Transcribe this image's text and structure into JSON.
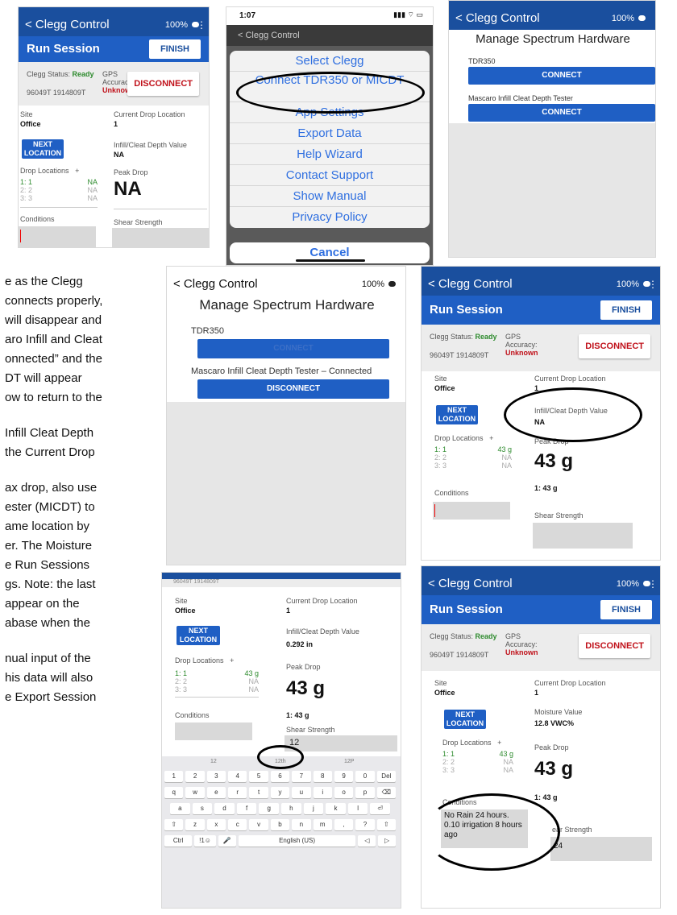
{
  "colors": {
    "app_blue": "#1a4f9e",
    "run_blue": "#1f5fc4",
    "ready_green": "#2e8b2e",
    "unknown_red": "#c0111a",
    "ios_blue": "#2f6fe0"
  },
  "common": {
    "back_title": "< Clegg Control",
    "battery_pct": "100%",
    "run_session": "Run Session",
    "finish": "FINISH",
    "clegg_status_label": "Clegg Status:",
    "clegg_status_value": "Ready",
    "gps_label": "GPS Accuracy:",
    "gps_value": "Unknown",
    "disconnect": "DISCONNECT",
    "serial": "96049T 1914809T",
    "site_label": "Site",
    "site_value": "Office",
    "current_drop_label": "Current Drop Location",
    "current_drop_value": "1",
    "next_location": "NEXT LOCATION",
    "drop_locations": "Drop Locations",
    "add_icon": "+",
    "peak_drop": "Peak Drop",
    "conditions": "Conditions",
    "shear_strength": "Shear Strength",
    "infill_label": "Infill/Cleat Depth Value"
  },
  "shot1": {
    "drops": [
      {
        "loc": "1: 1",
        "val": "NA"
      },
      {
        "loc": "2: 2",
        "val": "NA"
      },
      {
        "loc": "3: 3",
        "val": "NA"
      }
    ],
    "infill_value": "NA",
    "peak_value": "NA"
  },
  "shot2": {
    "time": "1:07",
    "title": "< Clegg Control",
    "menu": [
      "Select Clegg",
      "Connect TDR350 or MICDT",
      "App Settings",
      "Export Data",
      "Help Wizard",
      "Contact Support",
      "Show Manual",
      "Privacy Policy"
    ],
    "cancel": "Cancel"
  },
  "shot3": {
    "heading": "Manage Spectrum Hardware",
    "device1": "TDR350",
    "device2": "Mascaro Infill Cleat Depth Tester",
    "connect": "CONNECT"
  },
  "shot4": {
    "heading": "Manage Spectrum Hardware",
    "device1": "TDR350",
    "device1_btn": "CONNECT",
    "device2": "Mascaro Infill Cleat Depth Tester – Connected",
    "device2_btn": "DISCONNECT"
  },
  "shot5": {
    "drops": [
      {
        "loc": "1: 1",
        "val": "43 g"
      },
      {
        "loc": "2: 2",
        "val": "NA"
      },
      {
        "loc": "3: 3",
        "val": "NA"
      }
    ],
    "infill_value": "NA",
    "peak_value": "43 g",
    "peak_sub": "1: 43 g"
  },
  "shot6": {
    "serial_partial": "96049T 1914809T",
    "drops": [
      {
        "loc": "1: 1",
        "val": "43 g"
      },
      {
        "loc": "2: 2",
        "val": "NA"
      },
      {
        "loc": "3: 3",
        "val": "NA"
      }
    ],
    "infill_value": "0.292 in",
    "peak_value": "43 g",
    "peak_sub": "1: 43 g",
    "shear_input": "12",
    "suggestions": [
      "12",
      "12th",
      "12P"
    ],
    "row1": [
      "1",
      "2",
      "3",
      "4",
      "5",
      "6",
      "7",
      "8",
      "9",
      "0",
      "Del"
    ],
    "row2": [
      "q",
      "w",
      "e",
      "r",
      "t",
      "y",
      "u",
      "i",
      "o",
      "p",
      "⌫"
    ],
    "row3": [
      "a",
      "s",
      "d",
      "f",
      "g",
      "h",
      "j",
      "k",
      "l",
      "⏎"
    ],
    "row4": [
      "⇧",
      "z",
      "x",
      "c",
      "v",
      "b",
      "n",
      "m",
      ",",
      "?",
      "⇧"
    ],
    "row5": [
      "Ctrl",
      "!1☺",
      "mic",
      "English (US)",
      "◁",
      "▷"
    ]
  },
  "shot7": {
    "moisture_label": "Moisture Value",
    "moisture_value": "12.8 VWC%",
    "drops": [
      {
        "loc": "1: 1",
        "val": "43 g"
      },
      {
        "loc": "2: 2",
        "val": "NA"
      },
      {
        "loc": "3: 3",
        "val": "NA"
      }
    ],
    "peak_value": "43 g",
    "peak_sub": "1: 43 g",
    "conditions_text": "No Rain 24 hours. 0.10 irrigation 8 hours ago",
    "shear_partial": "ear Strength",
    "shear_value": "24"
  },
  "captions": [
    "e as the Clegg",
    "connects properly,",
    "will disappear and",
    "aro Infill and Cleat",
    "onnected” and the",
    "DT will appear",
    "ow to return to the",
    "",
    "Infill Cleat Depth",
    "the Current Drop",
    "",
    "ax drop, also use",
    "ester (MICDT) to",
    "ame location by",
    "er. The Moisture",
    "e Run Sessions",
    "gs. Note: the last",
    "appear on the",
    "abase when the",
    "",
    "nual input of the",
    "his data will also",
    "e Export Session"
  ]
}
